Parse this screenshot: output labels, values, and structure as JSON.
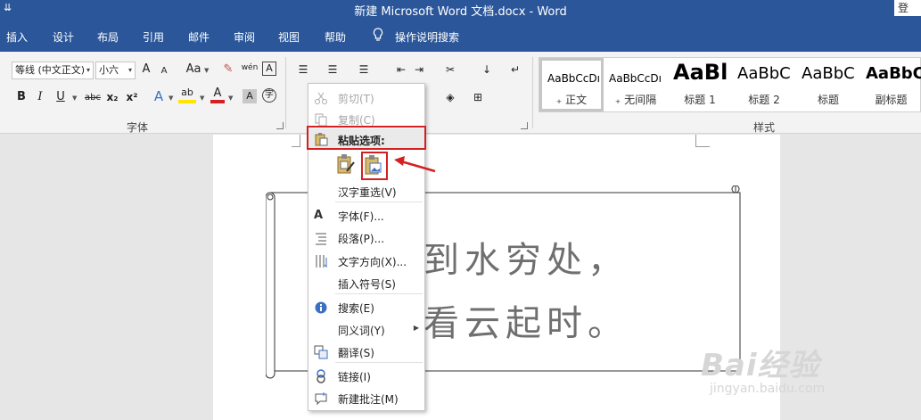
{
  "title_bar": {
    "title": "新建 Microsoft Word 文档.docx  -  Word",
    "qat_icon": "customize-qat-icon",
    "login": "登"
  },
  "tabs": [
    "插入",
    "设计",
    "布局",
    "引用",
    "邮件",
    "审阅",
    "视图",
    "帮助"
  ],
  "tell_me": {
    "label": "操作说明搜索",
    "icon": "lightbulb-icon"
  },
  "font_group": {
    "font_name": "等线 (中文正文)",
    "font_size": "小六",
    "buttons": {
      "bold": "B",
      "italic": "I",
      "underline": "U",
      "strike": "abc",
      "subscript": "x₂",
      "superscript": "x²",
      "font_color": "A",
      "clear": "Aa",
      "char_shade": "A",
      "grow": "A",
      "shrink": "A",
      "highlight": "ab",
      "phonetic": "wén",
      "border_char": "A",
      "enclose": "字"
    },
    "label": "字体"
  },
  "styles_group": {
    "label": "样式",
    "items": [
      {
        "sample": "AaBbCcDı",
        "name": "₊ 正文",
        "selected": true
      },
      {
        "sample": "AaBbCcDı",
        "name": "₊ 无间隔",
        "selected": false
      },
      {
        "sample": "AaBl",
        "name": "标题 1",
        "selected": false
      },
      {
        "sample": "AaBbC",
        "name": "标题 2",
        "selected": false
      },
      {
        "sample": "AaBbC",
        "name": "标题",
        "selected": false
      },
      {
        "sample": "AaBbC",
        "name": "副标题",
        "selected": false
      }
    ]
  },
  "document": {
    "lines": [
      "到水穷处，",
      "看云起时。"
    ]
  },
  "context_menu": {
    "cut": "剪切(T)",
    "copy": "复制(C)",
    "paste_options": "粘贴选项:",
    "hanzi_reselect": "汉字重选(V)",
    "font": "字体(F)...",
    "paragraph": "段落(P)...",
    "text_direction": "文字方向(X)...",
    "insert_symbol": "插入符号(S)",
    "search": "搜索(E)",
    "synonyms": "同义词(Y)",
    "translate": "翻译(S)",
    "link": "链接(I)",
    "new_comment": "新建批注(M)"
  },
  "watermark": {
    "brand": "Bai经验",
    "url": "jingyan.baidu.com"
  },
  "colors": {
    "accent": "#2b579a",
    "highlight_box": "#d42020"
  }
}
